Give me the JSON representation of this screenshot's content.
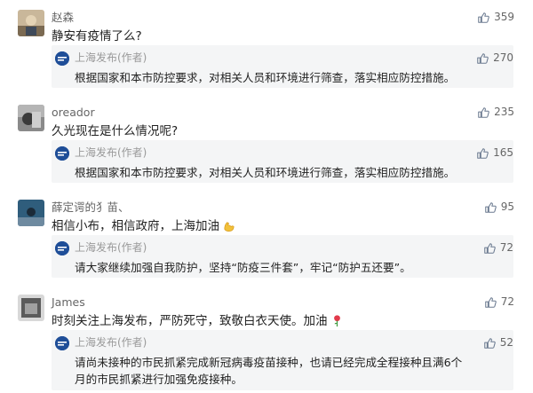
{
  "comments": [
    {
      "user": "赵森",
      "text": "静安有疫情了么?",
      "likes": "359",
      "reply": {
        "author": "上海发布(作者)",
        "text": "根据国家和本市防控要求，对相关人员和环境进行筛查，落实相应防控措施。",
        "likes": "270"
      }
    },
    {
      "user": "oreador",
      "text": "久光现在是什么情况呢?",
      "likes": "235",
      "reply": {
        "author": "上海发布(作者)",
        "text": "根据国家和本市防控要求，对相关人员和环境进行筛查，落实相应防控措施。",
        "likes": "165"
      }
    },
    {
      "user": "薛定谔的犭苗、",
      "text": "相信小布，相信政府，上海加油",
      "emoji": "flexed-biceps",
      "likes": "95",
      "reply": {
        "author": "上海发布(作者)",
        "text": "请大家继续加强自我防护，坚持“防疫三件套”，牢记“防护五还要”。",
        "likes": "72"
      }
    },
    {
      "user": "James",
      "text": "时刻关注上海发布，严防死守，致敬白衣天使。加油",
      "emoji": "rose",
      "likes": "72",
      "reply": {
        "author": "上海发布(作者)",
        "text_line1": "请尚未接种的市民抓紧完成新冠病毒疫苗接种，也请已经完成全程接种且满6个",
        "text_line2": "月的市民抓紧进行加强免疫接种。",
        "likes": "52"
      }
    }
  ],
  "colors": {
    "text": "#222222",
    "muted": "#666666",
    "reply_bg": "#f4f5f6",
    "official_avatar": "#1f4e98"
  }
}
